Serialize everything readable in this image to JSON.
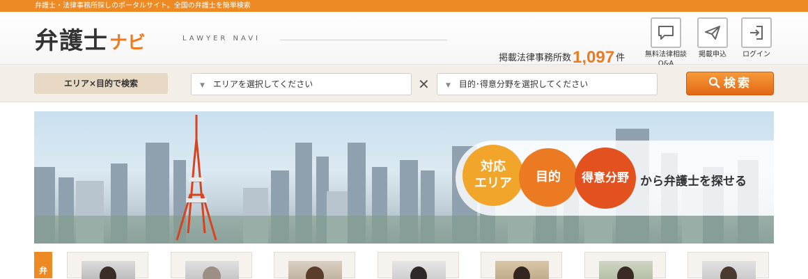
{
  "topbar": {
    "text": "弁護士・法律事務所探しのポータルサイト。全国の弁護士を簡単検索"
  },
  "header": {
    "logo_main": "弁護士",
    "logo_accent": "ナビ",
    "logo_sub": "LAWYER NAVI",
    "count_prefix": "掲載法律事務所数",
    "count_value": "1,097",
    "count_suffix": "件",
    "buttons": [
      {
        "label": "無料法律相談\nQ&A",
        "icon": "chat-bubble-icon"
      },
      {
        "label": "掲載申込",
        "icon": "paper-plane-icon"
      },
      {
        "label": "ログイン",
        "icon": "login-icon"
      }
    ]
  },
  "search": {
    "tag": "エリア×目的で検索",
    "area_placeholder": "エリアを選択してください",
    "purpose_placeholder": "目的･得意分野を選択してください",
    "times": "✕",
    "button_label": "検索"
  },
  "hero": {
    "circle1_line1": "対応",
    "circle1_line2": "エリア",
    "circle2": "目的",
    "circle3": "得意分野",
    "tagline": "から弁護士を探せる"
  },
  "lawyers_tag": "弁",
  "colors": {
    "accent": "#ee8a23",
    "brand_orange": "#ee7a1e",
    "search_button": "#e26813"
  }
}
